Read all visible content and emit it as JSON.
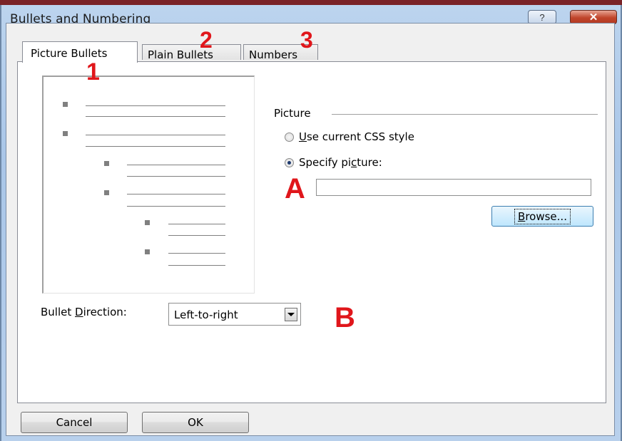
{
  "dialog": {
    "title": "Bullets and Numbering",
    "help_glyph": "?",
    "close_glyph": "✕"
  },
  "tabs": [
    {
      "label": "Picture Bullets",
      "active": true
    },
    {
      "label": "Plain Bullets",
      "active": false
    },
    {
      "label": "Numbers",
      "active": false
    }
  ],
  "picture": {
    "group_label": "Picture",
    "use_css_prefix": "",
    "use_css_accel": "U",
    "use_css_rest": "se current CSS style",
    "specify_prefix": "Specify pi",
    "specify_accel": "c",
    "specify_rest": "ture:",
    "selected_option": "specify",
    "path_value": "",
    "browse_accel": "B",
    "browse_rest": "rowse..."
  },
  "direction": {
    "label_prefix": "Bullet ",
    "label_accel": "D",
    "label_rest": "irection:",
    "value": "Left-to-right"
  },
  "footer": {
    "cancel_label": "Cancel",
    "ok_label": "OK"
  },
  "annotations": {
    "n1": "1",
    "n2": "2",
    "n3": "3",
    "a": "A",
    "b": "B"
  },
  "colors": {
    "annotation": "#e0161b",
    "title_bar_accent": "#7a2327",
    "close_button": "#c0452b"
  }
}
